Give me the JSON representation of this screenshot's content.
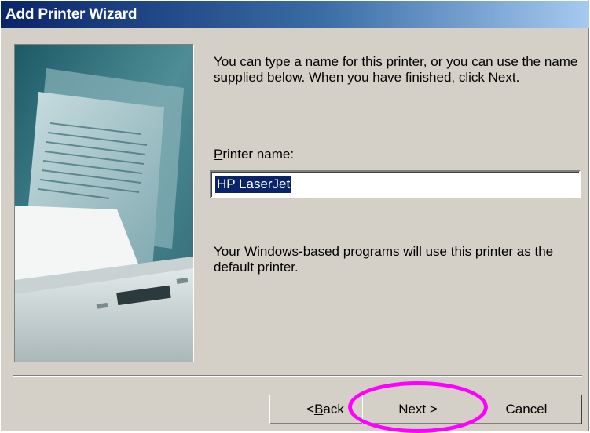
{
  "window": {
    "title": "Add Printer Wizard"
  },
  "intro_text": "You can type a name for this printer, or you can use the name supplied below. When you have finished, click Next.",
  "printer_name": {
    "label_accel": "P",
    "label_rest": "rinter name:",
    "value": "HP LaserJet"
  },
  "default_note": "Your Windows-based programs will use this printer as the default printer.",
  "buttons": {
    "back_prefix": "< ",
    "back_accel": "B",
    "back_rest": "ack",
    "next": "Next >",
    "cancel": "Cancel"
  },
  "colors": {
    "title_gradient_start": "#0a246a",
    "title_gradient_end": "#a6caf0",
    "dialog_face": "#d4d0c8",
    "selection": "#0a246a",
    "highlight_ellipse": "#ff00ff"
  },
  "icons": {
    "illustration": "printer-with-documents-illustration"
  }
}
